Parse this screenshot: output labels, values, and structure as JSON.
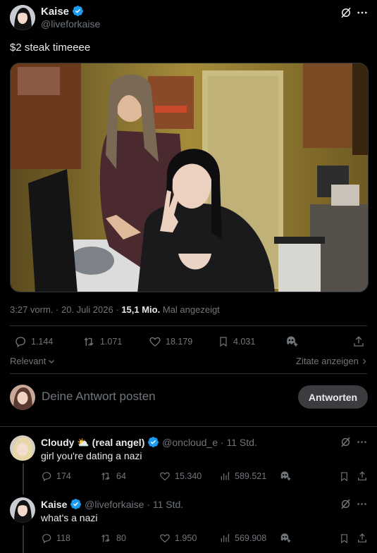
{
  "post": {
    "author_name": "Kaise",
    "author_handle": "@liveforkaise",
    "text": "$2 steak timeeee",
    "time": "3:27 vorm.",
    "date": "20. Juli 2026",
    "views_count": "15,1 Mio.",
    "views_label": "Mal angezeigt",
    "stats": {
      "replies": "1.144",
      "reposts": "1.071",
      "likes": "18.179",
      "bookmarks": "4.031"
    }
  },
  "sort": {
    "label": "Relevant",
    "quotes_link": "Zitate anzeigen"
  },
  "reply_box": {
    "placeholder": "Deine Antwort posten",
    "button": "Antworten"
  },
  "replies": [
    {
      "name": "Cloudy",
      "emoji": "⛅",
      "name_suffix": "(real angel)",
      "handle": "@oncloud_e",
      "time": "11 Std.",
      "text": "girl you're dating a nazi",
      "stats": {
        "replies": "174",
        "reposts": "64",
        "likes": "15.340",
        "views": "589.521"
      }
    },
    {
      "name": "Kaise",
      "handle": "@liveforkaise",
      "time": "11 Std.",
      "text": "what's a nazi",
      "stats": {
        "replies": "118",
        "reposts": "80",
        "likes": "1.950",
        "views": "569.908"
      }
    }
  ],
  "colors": {
    "background": "#000000",
    "accent": "#1d9bf0",
    "text": "#e7e9ea",
    "muted": "#71767b",
    "divider": "#2f3336"
  }
}
